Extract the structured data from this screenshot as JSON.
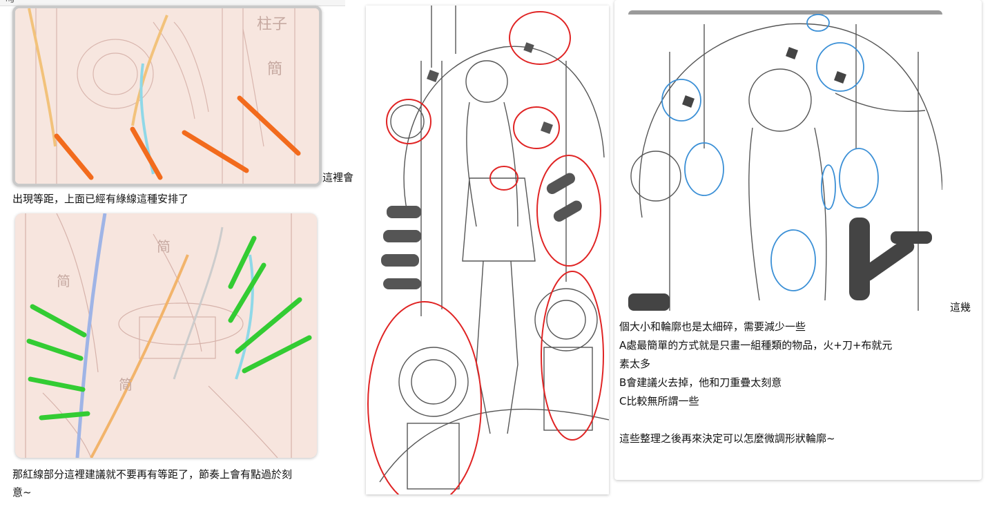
{
  "header": {
    "snippet": "ng"
  },
  "left_column": {
    "caption_1_part_a": "這裡會",
    "caption_1_part_b": "出現等距，上面已經有綠線這種安排了",
    "caption_2_line_1": "那紅線部分這裡建議就不要再有等距了，節奏上會有點過於刻",
    "caption_2_line_2": "意~"
  },
  "right_column": {
    "trailing_word": "這幾",
    "lines": [
      "個大小和輪廓也是太細碎，需要減少一些",
      "A處最簡單的方式就是只畫一組種類的物品，火+刀+布就元",
      "素太多",
      "B會建議火去掉，他和刀重疊太刻意",
      "C比較無所謂一些",
      "",
      "這些整理之後再來決定可以怎麼微調形狀輪廓~"
    ]
  },
  "colors": {
    "orange_stroke": "#f26b1d",
    "green_stroke": "#33cc33",
    "red_circle": "#e02424",
    "blue_circle": "#3a8fd6",
    "sketch_bg": "#f6e4dd"
  }
}
